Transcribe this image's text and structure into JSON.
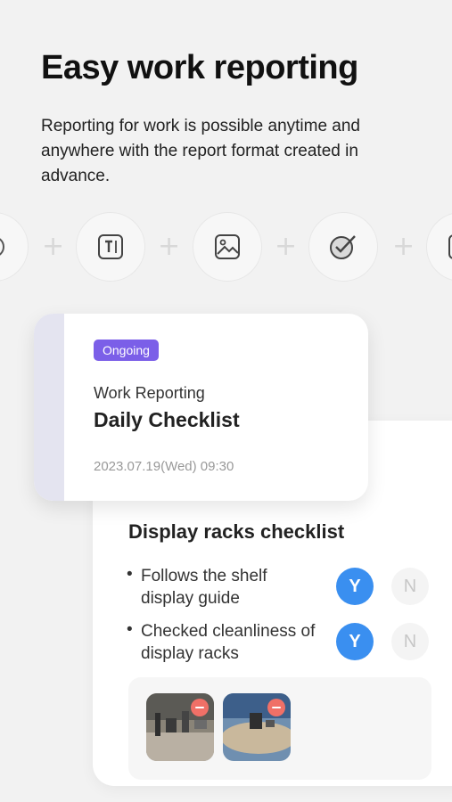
{
  "header": {
    "title": "Easy work reporting",
    "subtitle": "Reporting for work is possible anytime and anywhere with the report format created in advance."
  },
  "feature_icons": [
    {
      "icon": "partial-circle-icon"
    },
    {
      "icon": "text-field-icon"
    },
    {
      "icon": "image-icon"
    },
    {
      "icon": "checkmark-circle-icon"
    },
    {
      "icon": "partial-box-icon"
    }
  ],
  "separator": "+",
  "report_card": {
    "status_badge": "Ongoing",
    "category": "Work Reporting",
    "title": "Daily Checklist",
    "datetime": "2023.07.19(Wed) 09:30",
    "badge_color": "#7b5fe8"
  },
  "checklist": {
    "title": "Display racks checklist",
    "items": [
      {
        "bullet": "•",
        "text": "Follows the shelf display guide",
        "yes": "Y",
        "no": "N",
        "selected": "Y"
      },
      {
        "bullet": "•",
        "text": "Checked cleanliness of display racks",
        "yes": "Y",
        "no": "N",
        "selected": "Y"
      }
    ],
    "accent_color": "#3a8ff0",
    "photos": [
      {
        "name": "photo-thumbnail-1"
      },
      {
        "name": "photo-thumbnail-2"
      }
    ]
  }
}
